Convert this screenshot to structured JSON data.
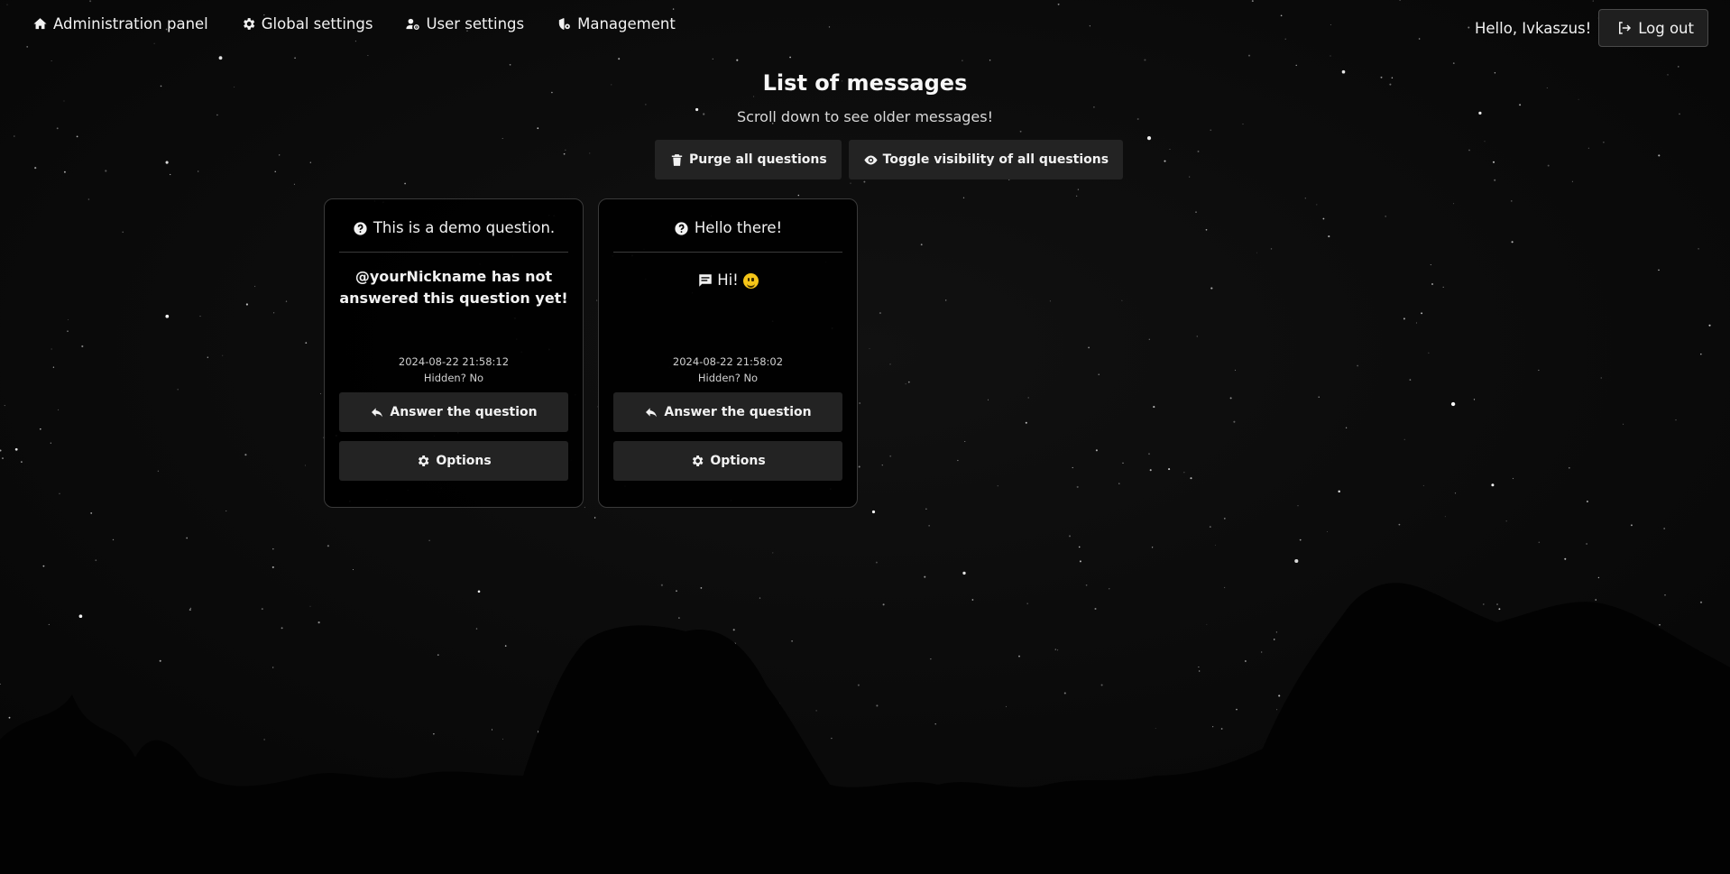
{
  "nav": {
    "links": [
      {
        "label": "Administration panel",
        "icon": "home-icon"
      },
      {
        "label": "Global settings",
        "icon": "gear-icon"
      },
      {
        "label": "User settings",
        "icon": "user-gear-icon"
      },
      {
        "label": "Management",
        "icon": "management-icon"
      }
    ],
    "greeting": "Hello, Ivkaszus!",
    "logout_label": "Log out"
  },
  "header": {
    "title": "List of messages",
    "subtitle": "Scroll down to see older messages!"
  },
  "actions": {
    "purge_label": "Purge all questions",
    "toggle_label": "Toggle visibility of all questions"
  },
  "cards": [
    {
      "question": "This is a demo question.",
      "body": "@yourNickname has not answered this question yet!",
      "timestamp": "2024-08-22 21:58:12",
      "hidden": "Hidden? No",
      "answer_label": "Answer the question",
      "options_label": "Options"
    },
    {
      "question": "Hello there!",
      "body": "Hi!",
      "timestamp": "2024-08-22 21:58:02",
      "hidden": "Hidden? No",
      "answer_label": "Answer the question",
      "options_label": "Options"
    }
  ],
  "colors": {
    "background": "#000000",
    "button": "#232323",
    "card_border": "#3a3a3a",
    "text": "#f2f2f2"
  }
}
